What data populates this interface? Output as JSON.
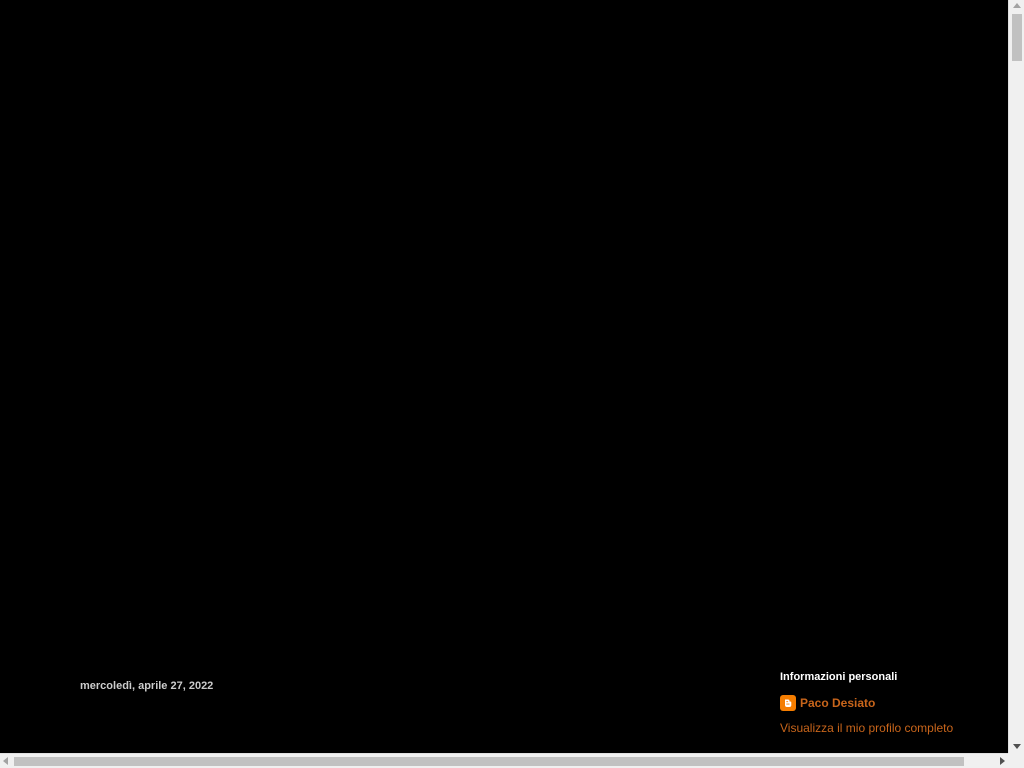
{
  "post": {
    "date_header": "mercoledì, aprile 27, 2022"
  },
  "sidebar": {
    "profile_widget": {
      "title": "Informazioni personali",
      "name": "Paco Desiato",
      "view_profile_link": "Visualizza il mio profilo completo",
      "icon": "blogger-icon"
    }
  },
  "colors": {
    "background": "#000000",
    "link": "#c8651b",
    "heading": "#ffffff",
    "date": "#cccccc",
    "blogger_brand": "#f57d00"
  }
}
